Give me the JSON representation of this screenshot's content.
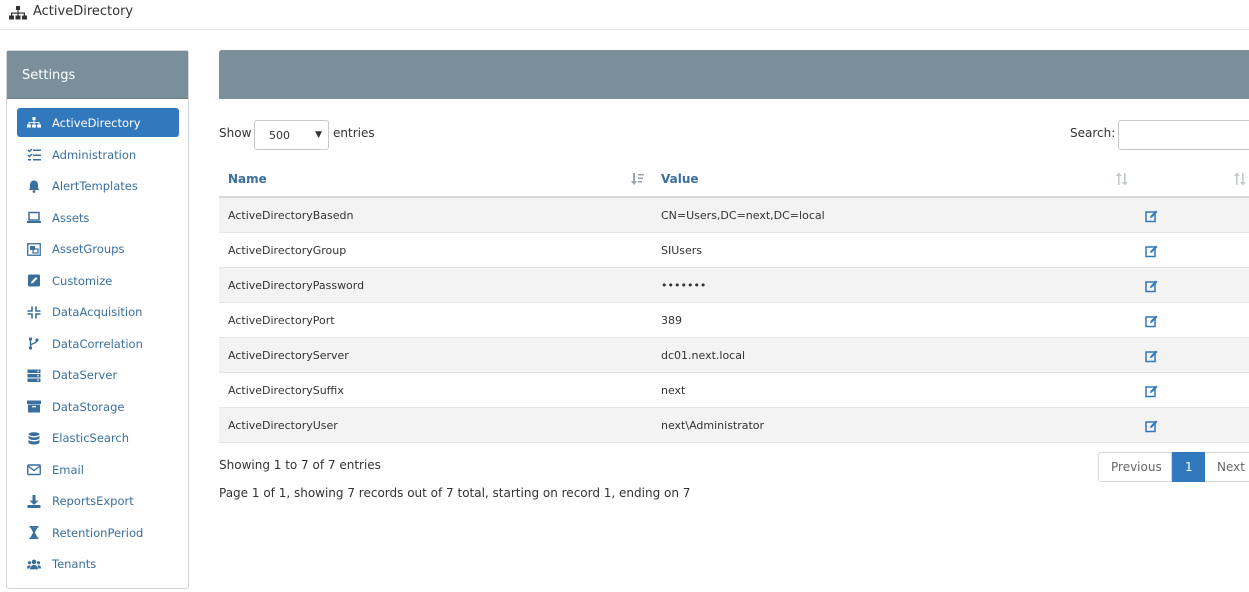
{
  "app": {
    "title": "ActiveDirectory",
    "icon": "sitemap-icon"
  },
  "sidebar": {
    "title": "Settings",
    "active_index": 0,
    "items": [
      {
        "label": "ActiveDirectory",
        "icon": "sitemap-icon"
      },
      {
        "label": "Administration",
        "icon": "list-check-icon"
      },
      {
        "label": "AlertTemplates",
        "icon": "bell-icon"
      },
      {
        "label": "Assets",
        "icon": "laptop-icon"
      },
      {
        "label": "AssetGroups",
        "icon": "object-group-icon"
      },
      {
        "label": "Customize",
        "icon": "edit-square-icon"
      },
      {
        "label": "DataAcquisition",
        "icon": "compress-icon"
      },
      {
        "label": "DataCorrelation",
        "icon": "code-branch-icon"
      },
      {
        "label": "DataServer",
        "icon": "server-icon"
      },
      {
        "label": "DataStorage",
        "icon": "archive-icon"
      },
      {
        "label": "ElasticSearch",
        "icon": "database-icon"
      },
      {
        "label": "Email",
        "icon": "envelope-icon"
      },
      {
        "label": "ReportsExport",
        "icon": "download-icon"
      },
      {
        "label": "RetentionPeriod",
        "icon": "hourglass-icon"
      },
      {
        "label": "Tenants",
        "icon": "users-icon"
      }
    ]
  },
  "controls": {
    "show_label": "Show",
    "entries_value": "500",
    "entries_label": "entries",
    "search_label": "Search:",
    "search_value": ""
  },
  "table": {
    "columns": {
      "name": "Name",
      "value": "Value"
    },
    "rows": [
      {
        "name": "ActiveDirectoryBasedn",
        "value": "CN=Users,DC=next,DC=local"
      },
      {
        "name": "ActiveDirectoryGroup",
        "value": "SIUsers"
      },
      {
        "name": "ActiveDirectoryPassword",
        "value": "•••••••"
      },
      {
        "name": "ActiveDirectoryPort",
        "value": "389"
      },
      {
        "name": "ActiveDirectoryServer",
        "value": "dc01.next.local"
      },
      {
        "name": "ActiveDirectorySuffix",
        "value": "next"
      },
      {
        "name": "ActiveDirectoryUser",
        "value": "next\\Administrator"
      }
    ]
  },
  "footer": {
    "info": "Showing 1 to 7 of 7 entries",
    "page_info": "Page 1 of 1, showing 7 records out of 7 total, starting on record 1, ending on 7"
  },
  "pagination": {
    "previous": "Previous",
    "current": "1",
    "next": "Next"
  },
  "colors": {
    "accent": "#3278bd",
    "header_bg": "#7b8f9b",
    "link": "#3a6f9d"
  }
}
